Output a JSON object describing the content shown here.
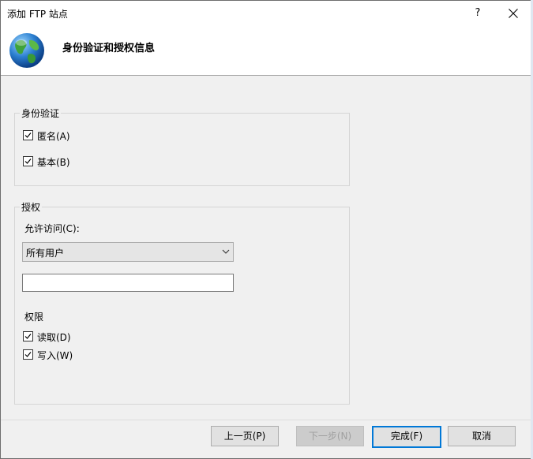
{
  "window": {
    "title": "添加 FTP 站点",
    "help_label": "?"
  },
  "header": {
    "title": "身份验证和授权信息"
  },
  "authentication": {
    "group_label": "身份验证",
    "anonymous_label": "匿名(A)",
    "anonymous_checked": true,
    "basic_label": "基本(B)",
    "basic_checked": true
  },
  "authorization": {
    "group_label": "授权",
    "allow_access_label": "允许访问(C):",
    "allow_access_value": "所有用户",
    "users_textbox_value": "",
    "permissions_label": "权限",
    "read_label": "读取(D)",
    "read_checked": true,
    "write_label": "写入(W)",
    "write_checked": true
  },
  "buttons": {
    "previous": "上一页(P)",
    "next": "下一步(N)",
    "finish": "完成(F)",
    "cancel": "取消"
  }
}
